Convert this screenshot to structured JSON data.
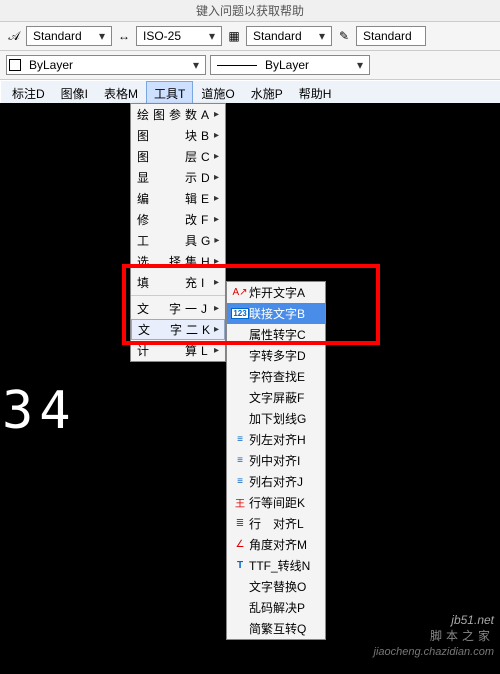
{
  "header": {
    "helptext": "键入问题以获取帮助"
  },
  "tb1": {
    "style1": "Standard",
    "style2": "ISO-25",
    "style3": "Standard",
    "style4": "Standard"
  },
  "tb2": {
    "layer": "ByLayer",
    "color": "ByLayer"
  },
  "menubar": {
    "items": [
      "标注D",
      "图像I",
      "表格M",
      "工具T",
      "道施O",
      "水施P",
      "帮助H"
    ],
    "active": 3
  },
  "menu1": [
    {
      "label": "绘图参数A",
      "arrow": true
    },
    {
      "label": "图　　块B",
      "arrow": true
    },
    {
      "label": "图　　层C",
      "arrow": true
    },
    {
      "label": "显　　示D",
      "arrow": true
    },
    {
      "label": "编　　辑E",
      "arrow": true
    },
    {
      "label": "修　　改F",
      "arrow": true
    },
    {
      "label": "工　　具G",
      "arrow": true
    },
    {
      "label": "选　择集H",
      "arrow": true
    },
    {
      "label": "填　　充I",
      "arrow": true
    },
    {
      "label": "文　字一J",
      "arrow": true
    },
    {
      "label": "文　字二K",
      "arrow": true,
      "sel": true
    },
    {
      "label": "计　　算L",
      "arrow": true
    }
  ],
  "menu2": [
    {
      "icon": "A↗",
      "label": "炸开文字A"
    },
    {
      "icon": "123",
      "label": "联接文字B",
      "sel": true
    },
    {
      "icon": "",
      "label": "属性转字C"
    },
    {
      "icon": "",
      "label": "字转多字D"
    },
    {
      "icon": "",
      "label": "字符查找E"
    },
    {
      "icon": "",
      "label": "文字屏蔽F"
    },
    {
      "icon": "",
      "label": "加下划线G"
    },
    {
      "icon": "≡",
      "label": "列左对齐H"
    },
    {
      "icon": "≡",
      "label": "列中对齐I"
    },
    {
      "icon": "≡",
      "label": "列右对齐J"
    },
    {
      "icon": "王",
      "label": "行等间距K"
    },
    {
      "icon": "≣",
      "label": "行　对齐L"
    },
    {
      "icon": "∠",
      "label": "角度对齐M"
    },
    {
      "icon": "T",
      "label": "TTF_转线N"
    },
    {
      "icon": "",
      "label": "文字替换O"
    },
    {
      "icon": "",
      "label": "乱码解决P"
    },
    {
      "icon": "",
      "label": "简繁互转Q"
    }
  ],
  "canvas": {
    "numtext": "34"
  },
  "wm": {
    "l1": "jb51.net",
    "l2": "脚本之家",
    "l3": "jiaocheng.chazidian.com"
  }
}
